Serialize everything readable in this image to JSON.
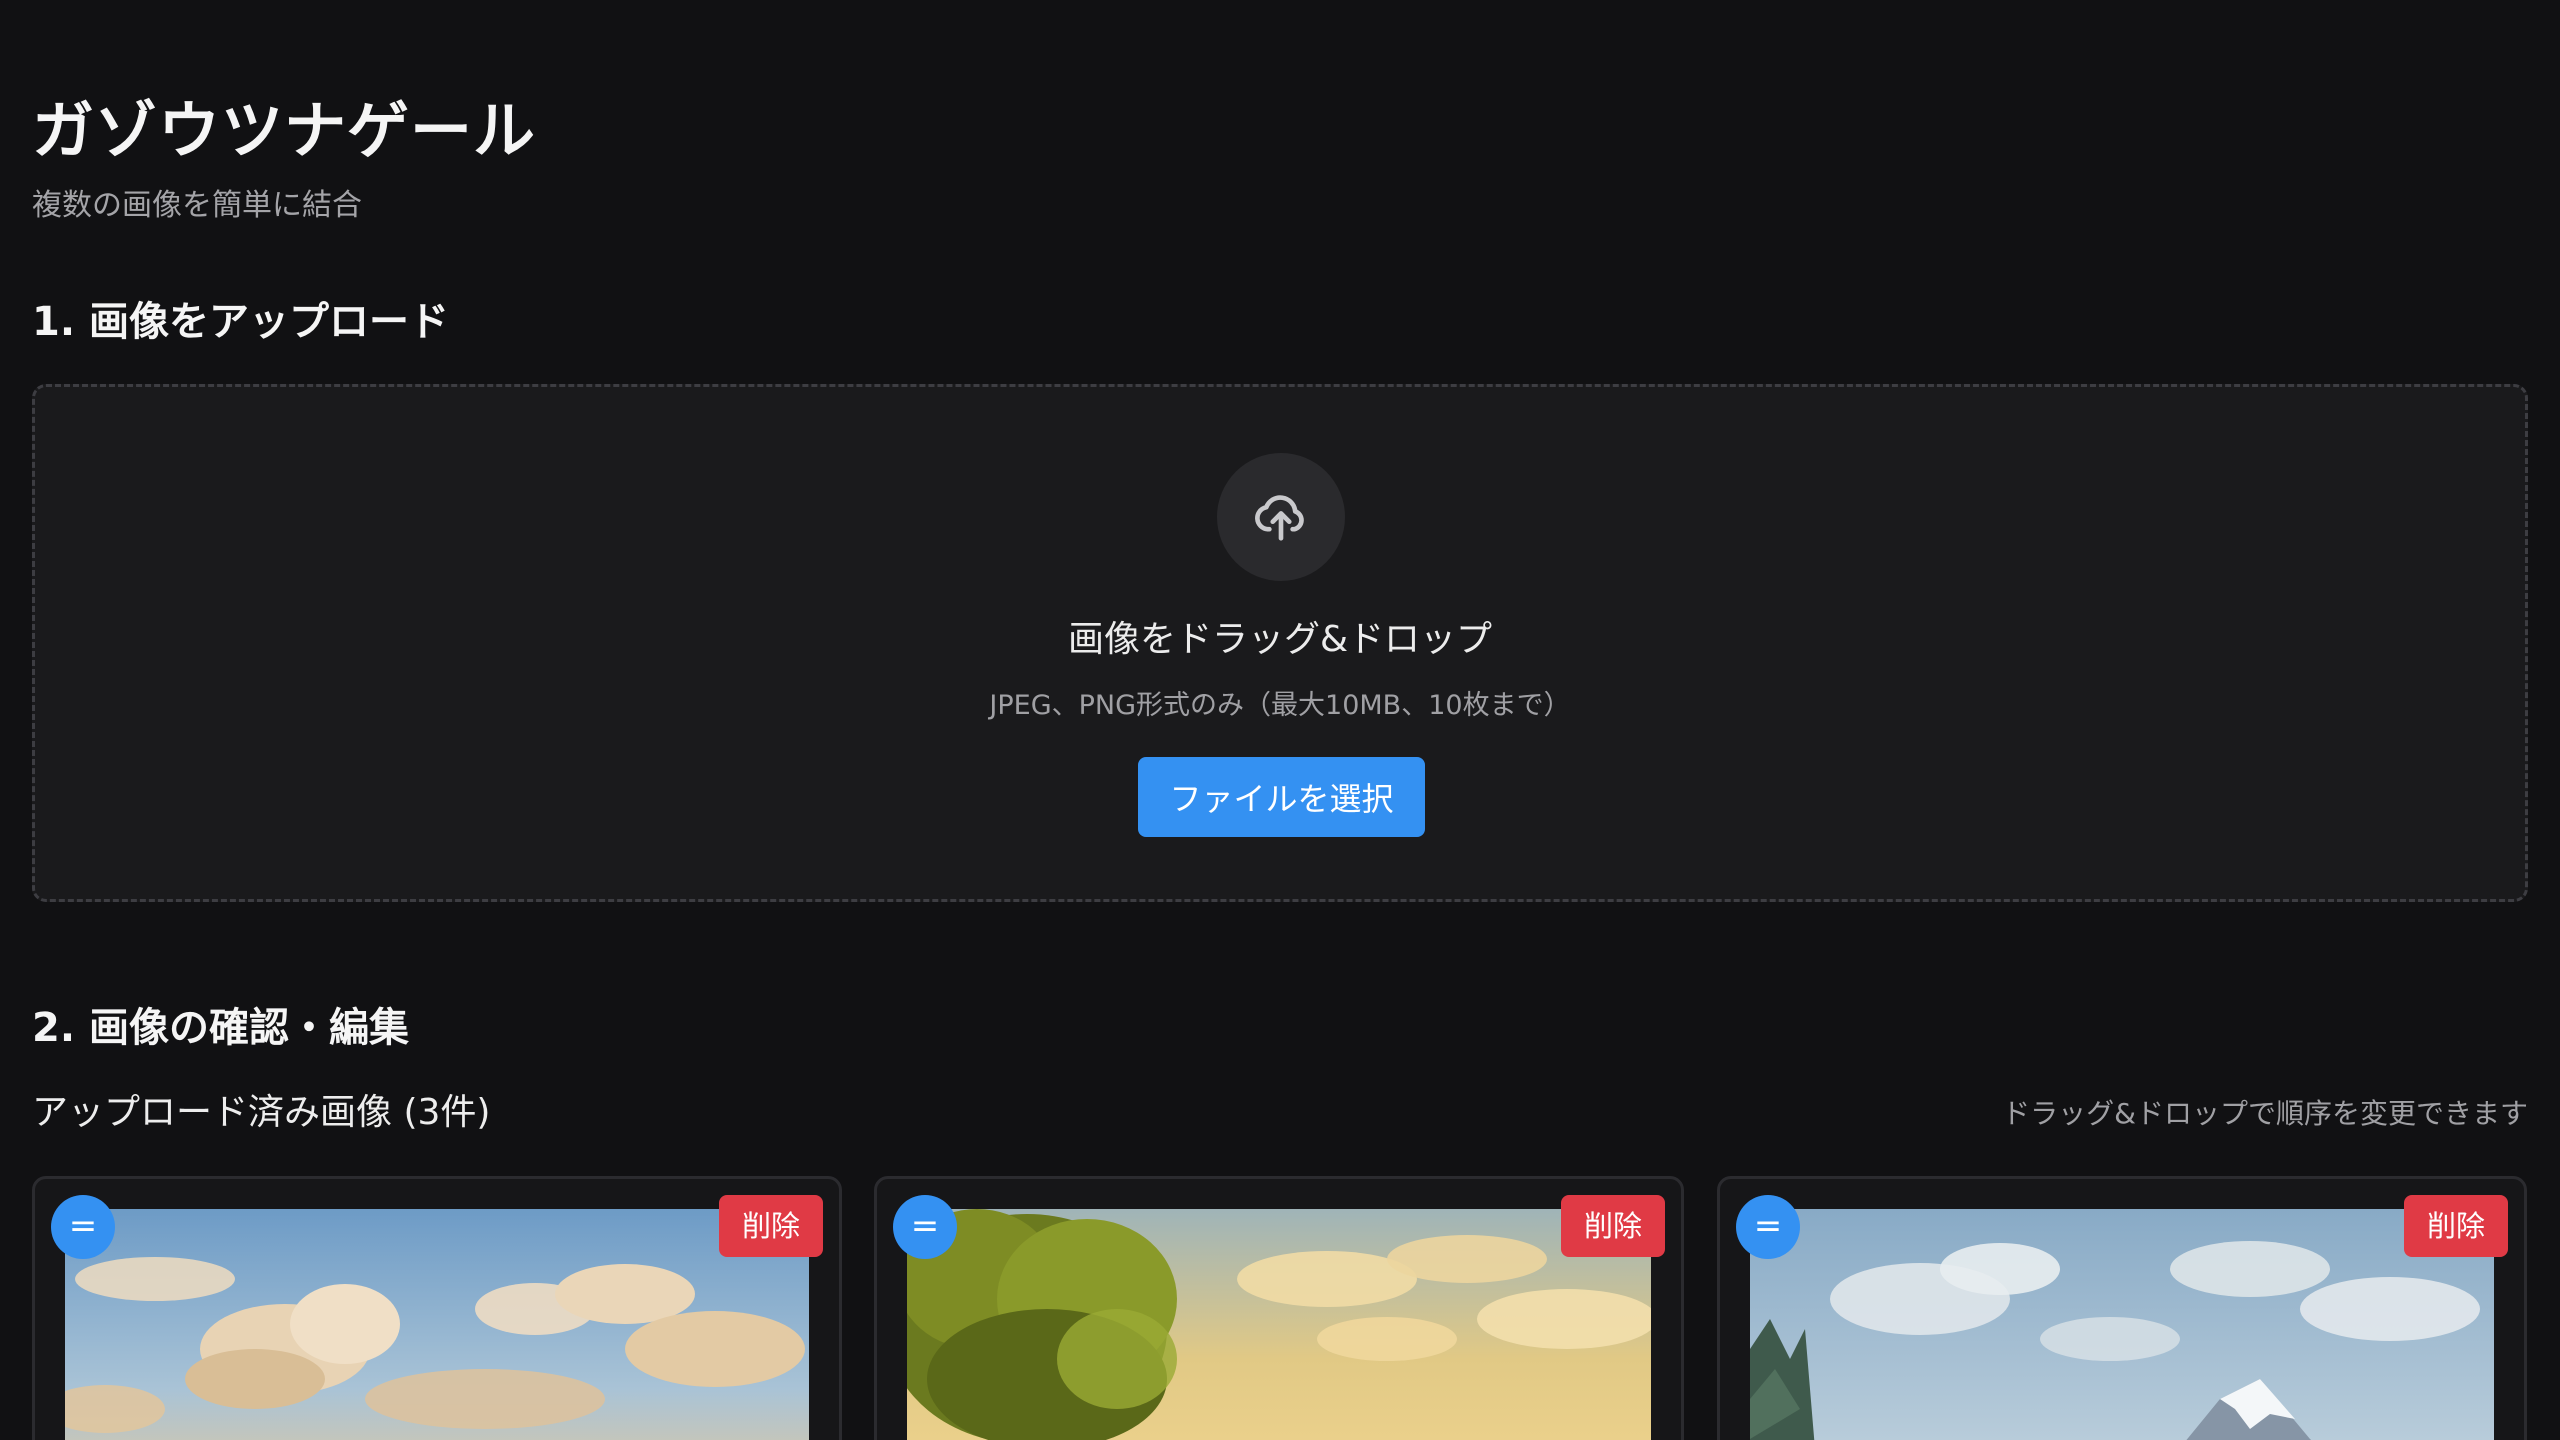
{
  "app": {
    "title": "ガゾウツナゲール",
    "subtitle": "複数の画像を簡単に結合"
  },
  "upload_section": {
    "title": "1. 画像をアップロード",
    "icon": "cloud-upload-icon",
    "drop_heading": "画像をドラッグ&ドロップ",
    "drop_hint": "JPEG、PNG形式のみ（最大10MB、10枚まで）",
    "select_button_label": "ファイルを選択"
  },
  "edit_section": {
    "title": "2. 画像の確認・編集",
    "uploaded_label": "アップロード済み画像 (3件)",
    "reorder_hint": "ドラッグ&ドロップで順序を変更できます",
    "images": [
      {
        "handle_label": "=",
        "delete_label": "削除",
        "thumbnail": "sky-clouds-landscape"
      },
      {
        "handle_label": "=",
        "delete_label": "削除",
        "thumbnail": "tree-golden-hour-landscape"
      },
      {
        "handle_label": "=",
        "delete_label": "削除",
        "thumbnail": "snowy-mountain-landscape"
      }
    ]
  },
  "colors": {
    "background": "#111113",
    "accent": "#3491f2",
    "danger": "#e03a45",
    "dropzone_background": "#1a1a1c"
  }
}
